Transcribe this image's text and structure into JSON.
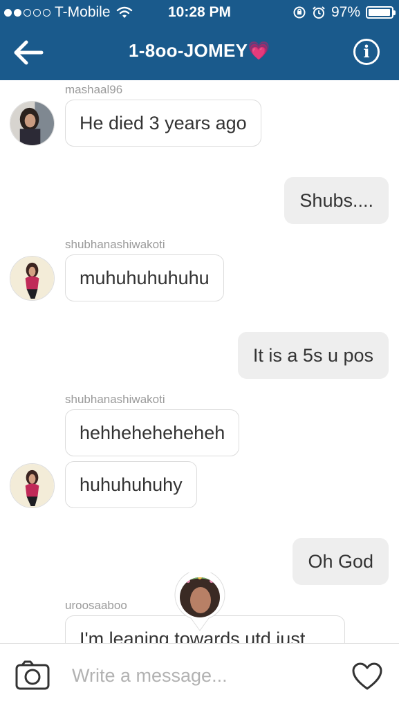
{
  "status_bar": {
    "carrier": "T-Mobile",
    "time": "10:28 PM",
    "battery_percent": "97%",
    "battery_level": 0.97,
    "signal_bars_filled": 2,
    "signal_bars_total": 5
  },
  "nav": {
    "title": "1-8oo-JOMEY",
    "title_emoji": "💗",
    "back_icon": "arrow-left-icon",
    "info_icon": "info-icon",
    "info_glyph": "i"
  },
  "messages": [
    {
      "type": "incoming",
      "username": "mashaal96",
      "text": "He died 3 years ago"
    },
    {
      "type": "outgoing",
      "text": "Shubs...."
    },
    {
      "type": "incoming",
      "username": "shubhanashiwakoti",
      "text": "muhuhuhuhuhu"
    },
    {
      "type": "outgoing",
      "text": "It is a 5s u pos"
    },
    {
      "type": "incoming",
      "username": "shubhanashiwakoti",
      "text": "hehheheheheheh"
    },
    {
      "type": "incoming",
      "text": "huhuhuhuhy"
    },
    {
      "type": "outgoing",
      "text": "Oh God"
    },
    {
      "type": "incoming",
      "username": "uroosaaboo",
      "text": "I'm leaning towards utd just"
    }
  ],
  "composer": {
    "placeholder": "Write a message...",
    "camera_icon": "camera-icon",
    "heart_icon": "heart-icon"
  },
  "colors": {
    "header_bg": "#1a5a8c",
    "outgoing_bubble": "#eeeeee",
    "incoming_border": "#dcdcdc",
    "username_text": "#9a9a9a"
  }
}
